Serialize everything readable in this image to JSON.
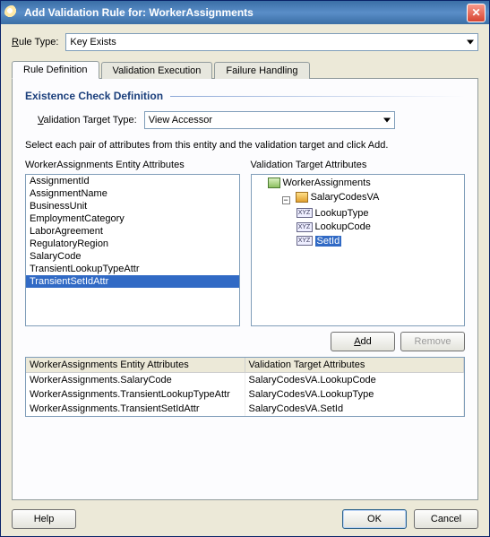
{
  "title": "Add Validation Rule for:  WorkerAssignments",
  "ruleType": {
    "label": "Rule Type:",
    "value": "Key Exists",
    "accessKey": "R"
  },
  "tabs": [
    {
      "id": "def",
      "label": "Rule Definition",
      "active": true
    },
    {
      "id": "exec",
      "label": "Validation Execution",
      "active": false
    },
    {
      "id": "fail",
      "label": "Failure Handling",
      "active": false
    }
  ],
  "section": {
    "heading": "Existence Check Definition"
  },
  "targetType": {
    "label": "Validation Target Type:",
    "value": "View Accessor",
    "accessKey": "V"
  },
  "hint": "Select each pair of attributes from this entity and the validation target and click Add.",
  "entityList": {
    "caption": "WorkerAssignments Entity Attributes",
    "items": [
      {
        "label": "AssignmentId",
        "selected": false
      },
      {
        "label": "AssignmentName",
        "selected": false
      },
      {
        "label": "BusinessUnit",
        "selected": false
      },
      {
        "label": "EmploymentCategory",
        "selected": false
      },
      {
        "label": "LaborAgreement",
        "selected": false
      },
      {
        "label": "RegulatoryRegion",
        "selected": false
      },
      {
        "label": "SalaryCode",
        "selected": false
      },
      {
        "label": "TransientLookupTypeAttr",
        "selected": false
      },
      {
        "label": "TransientSetIdAttr",
        "selected": true
      }
    ]
  },
  "targetTree": {
    "caption": "Validation Target Attributes",
    "root": {
      "label": "WorkerAssignments"
    },
    "va": {
      "label": "SalaryCodesVA"
    },
    "attrs": [
      {
        "label": "LookupType",
        "selected": false
      },
      {
        "label": "LookupCode",
        "selected": false
      },
      {
        "label": "SetId",
        "selected": true
      }
    ]
  },
  "buttons": {
    "add": "Add",
    "remove": "Remove",
    "help": "Help",
    "ok": "OK",
    "cancel": "Cancel"
  },
  "mapping": {
    "headers": [
      "WorkerAssignments Entity Attributes",
      "Validation Target Attributes"
    ],
    "rows": [
      [
        "WorkerAssignments.SalaryCode",
        "SalaryCodesVA.LookupCode"
      ],
      [
        "WorkerAssignments.TransientLookupTypeAttr",
        "SalaryCodesVA.LookupType"
      ],
      [
        "WorkerAssignments.TransientSetIdAttr",
        "SalaryCodesVA.SetId"
      ]
    ]
  }
}
